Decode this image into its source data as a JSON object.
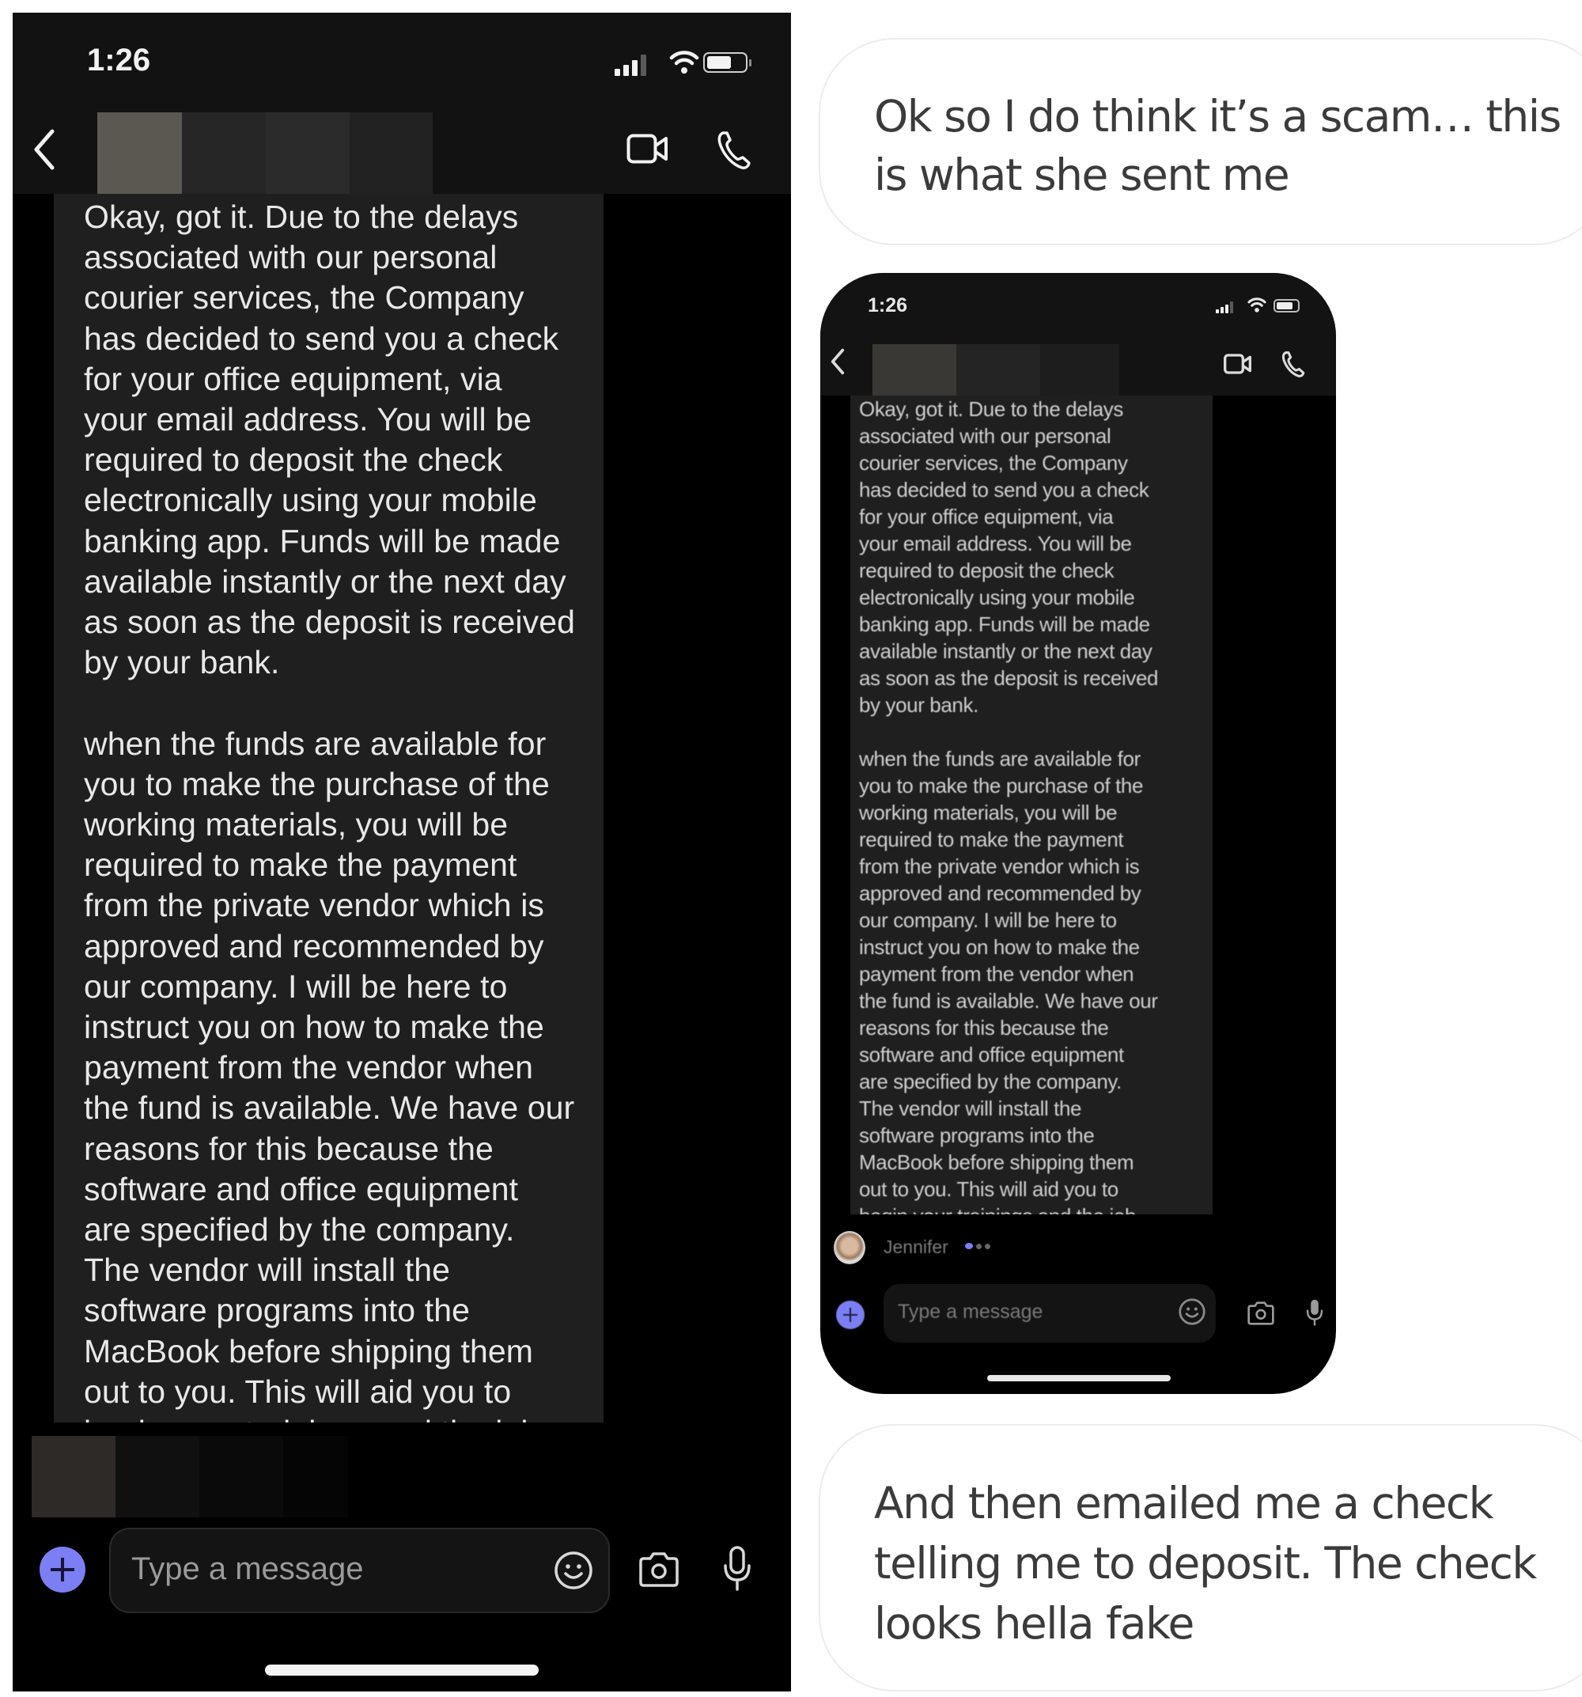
{
  "left_phone": {
    "status_bar": {
      "time": "1:26",
      "icons": [
        "cellular-signal-icon",
        "wifi-icon",
        "battery-icon"
      ]
    },
    "header": {
      "back_icon": "chevron-left-icon",
      "contact_name": "[redacted]",
      "actions": [
        "video-call-icon",
        "phone-call-icon"
      ]
    },
    "message": {
      "text": "Okay, got it. Due to the delays\nassociated with our personal\ncourier services, the Company\nhas decided to send you a check\nfor your office equipment, via\nyour email address. You will be\nrequired to deposit the check\nelectronically using your mobile\nbanking app. Funds will be made\navailable instantly or the next day\nas soon as the deposit is received\nby your bank.\n\nwhen the funds are available for\nyou to make the purchase of the\nworking materials, you will be\nrequired to make the payment\nfrom the private vendor which is\napproved and recommended by\nour company. I will be here to\ninstruct you on how to make the\npayment from the vendor when\nthe fund is available. We have our\nreasons for this because the\nsoftware and office equipment\nare specified by the company.\nThe vendor will install the\nsoftware programs into the\nMacBook before shipping them\nout to you. This will aid you to\nbegin your trainings and the job"
    },
    "sender": "[redacted]",
    "composer": {
      "placeholder": "Type a message",
      "icons": [
        "plus-icon",
        "emoji-icon",
        "camera-icon",
        "microphone-icon"
      ]
    }
  },
  "right_panel": {
    "message_1": "Ok so I do think it’s a scam… this is what she sent me",
    "inner_phone": {
      "status_bar": {
        "time": "1:26"
      },
      "header": {
        "contact_name": "[redacted]"
      },
      "message": {
        "text": "Okay, got it. Due to the delays\nassociated with our personal\ncourier services, the Company\nhas decided to send you a check\nfor your office equipment, via\nyour email address. You will be\nrequired to deposit the check\nelectronically using your mobile\nbanking app. Funds will be made\navailable instantly or the next day\nas soon as the deposit is received\nby your bank.\n\nwhen the funds are available for\nyou to make the purchase of the\nworking materials, you will be\nrequired to make the payment\nfrom the private vendor which is\napproved and recommended by\nour company. I will be here to\ninstruct you on how to make the\npayment from the vendor when\nthe fund is available. We have our\nreasons for this because the\nsoftware and office equipment\nare specified by the company.\nThe vendor will install the\nsoftware programs into the\nMacBook before shipping them\nout to you. This will aid you to\nbegin your trainings and the job"
      },
      "sender": "Jennifer",
      "typing_indicator": true,
      "composer": {
        "placeholder": "Type a message"
      }
    },
    "message_2": "And then emailed me a check telling me to deposit. The check looks hella fake"
  },
  "colors": {
    "accent_purple": "#7b7ff3",
    "bubble_dark": "#1f1f1f",
    "header_dark": "#121212",
    "text_light": "#e8e8e8",
    "text_dark": "#3b3b3b"
  }
}
